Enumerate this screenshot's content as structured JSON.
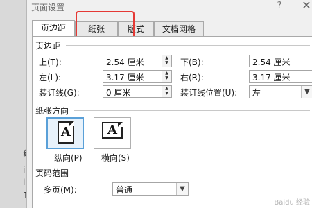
{
  "dialog": {
    "title": "页面设置",
    "help_label": "?",
    "close_label": "✕"
  },
  "tabs": [
    {
      "label": "页边距",
      "active": true
    },
    {
      "label": "纸张",
      "active": false
    },
    {
      "label": "版式",
      "active": false
    },
    {
      "label": "文档网格",
      "active": false
    }
  ],
  "margins": {
    "section_title": "页边距",
    "top_label": "上(T):",
    "top_value": "2.54 厘米",
    "bottom_label": "下(B):",
    "bottom_value": "2.54 厘米",
    "left_label": "左(L):",
    "left_value": "3.17 厘米",
    "right_label": "右(R):",
    "right_value": "3.17 厘米",
    "gutter_label": "装订线(G):",
    "gutter_value": "0 厘米",
    "gutter_pos_label": "装订线位置(U):",
    "gutter_pos_value": "左"
  },
  "orientation": {
    "section_title": "纸张方向",
    "portrait_label": "纵向(P)",
    "landscape_label": "横向(S)",
    "icon_letter": "A",
    "selected": "portrait"
  },
  "pages": {
    "section_title": "页码范围",
    "multi_label": "多页(M):",
    "multi_value": "普通"
  },
  "background": {
    "left_glyphs": [
      "纟",
      "i",
      "i",
      "1"
    ]
  },
  "watermark": "Baidu 经验",
  "colors": {
    "highlight": "#e53935",
    "selected_border": "#5aa0d8"
  }
}
